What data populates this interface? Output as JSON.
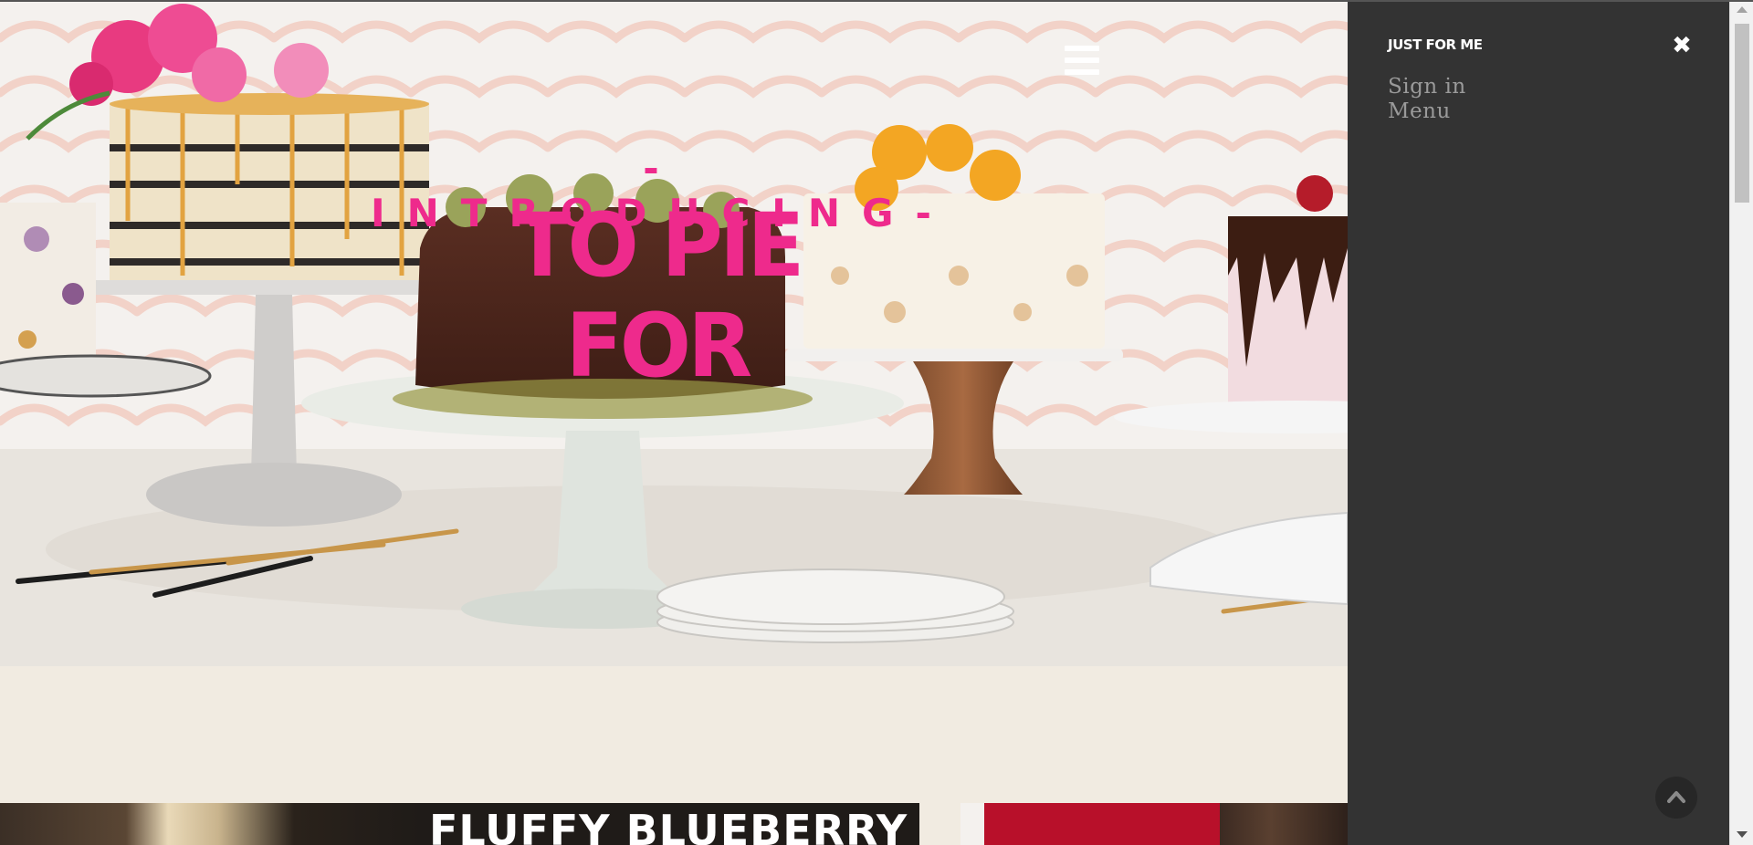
{
  "hero": {
    "intro": "-INTRODUCING-",
    "title": "TO PIE FOR",
    "menu_icon": "hamburger-icon"
  },
  "cards": {
    "left_title": "FLUFFY BLUEBERRY"
  },
  "panel": {
    "title": "JUST FOR ME",
    "close_icon": "close-icon",
    "close_glyph": "✖",
    "links": [
      {
        "label": "Sign in"
      },
      {
        "label": "Menu"
      }
    ],
    "back_to_top_icon": "chevron-up-icon"
  },
  "colors": {
    "brand_pink": "#ee2a8c",
    "panel_bg": "#333333",
    "page_bg": "#f1ebe1",
    "panel_link": "#9a9a9a"
  }
}
